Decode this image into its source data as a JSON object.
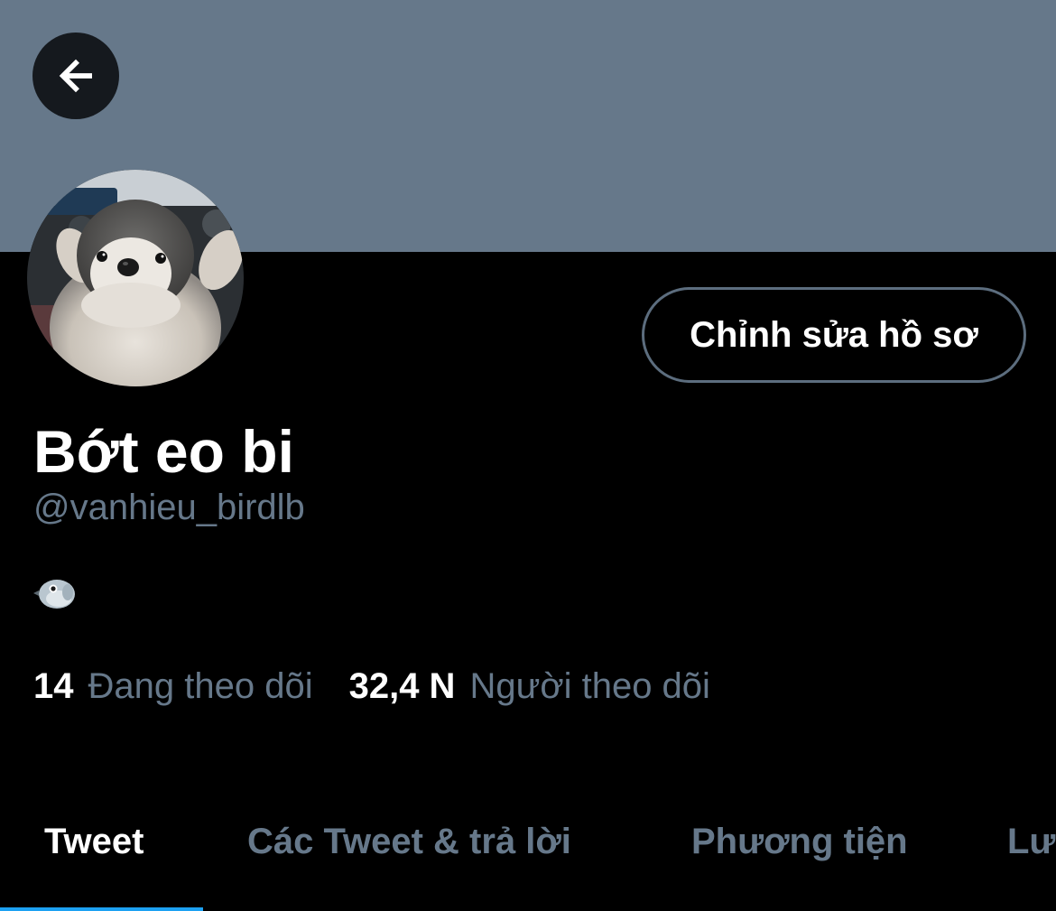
{
  "header": {
    "back_icon": "arrow-left-icon",
    "banner_color": "#66788a"
  },
  "profile": {
    "avatar_description_icon": "penguin-avatar",
    "edit_button_label": "Chỉnh sửa hồ sơ",
    "display_name": "Bớt eo bi",
    "handle": "@vanhieu_birdlb",
    "bio_icon": "bird-emoji-icon"
  },
  "stats": {
    "following_count": "14",
    "following_label": "Đang theo dõi",
    "followers_count": "32,4 N",
    "followers_label": "Người theo dõi"
  },
  "tabs": [
    {
      "label": "Tweet",
      "active": true
    },
    {
      "label": "Các Tweet & trả lời",
      "active": false
    },
    {
      "label": "Phương tiện",
      "active": false
    },
    {
      "label": "Lượt thích",
      "active": false
    }
  ],
  "colors": {
    "accent": "#1da1f2",
    "secondary_text": "#66788a",
    "background": "#000000"
  }
}
